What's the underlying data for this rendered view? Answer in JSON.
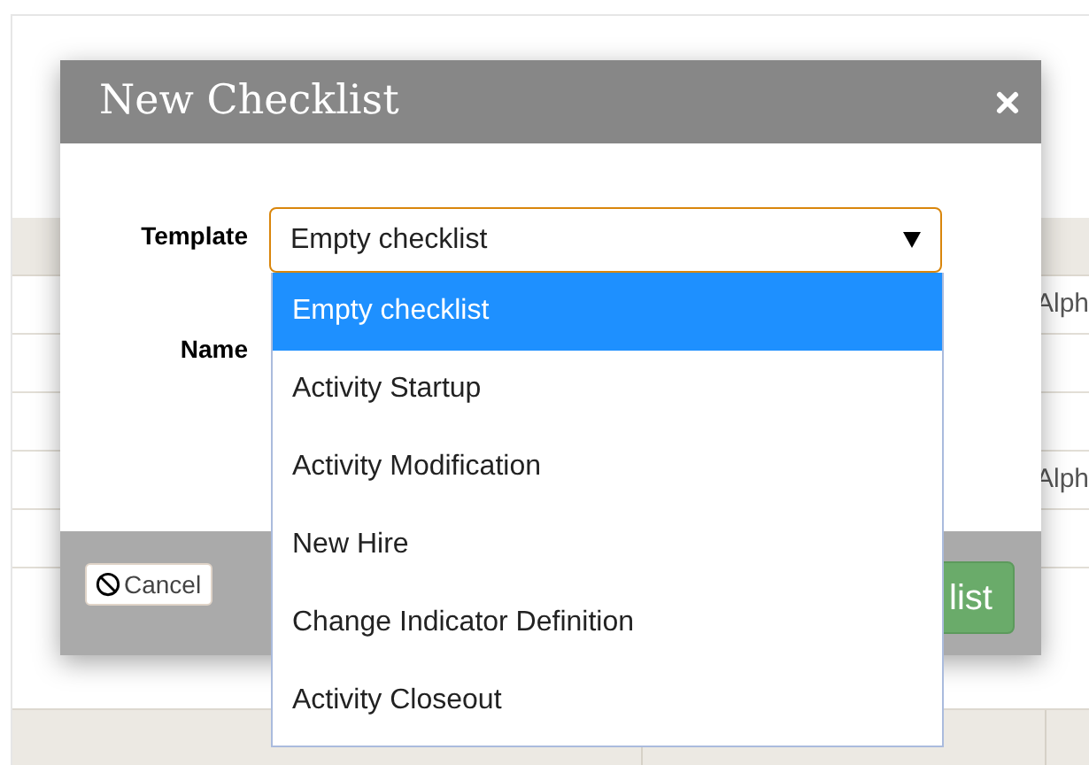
{
  "background_table": {
    "rows": [
      {
        "column_1": "Alph"
      },
      {},
      {},
      {
        "column_1": "Alph"
      },
      {}
    ]
  },
  "dialog": {
    "title": "New Checklist",
    "template_label": "Template",
    "template_value": "Empty checklist",
    "name_label": "Name",
    "template_options": [
      {
        "label": "Empty checklist",
        "selected": true
      },
      {
        "label": "Activity Startup",
        "selected": false
      },
      {
        "label": "Activity Modification",
        "selected": false
      },
      {
        "label": "New Hire",
        "selected": false
      },
      {
        "label": "Change Indicator Definition",
        "selected": false
      },
      {
        "label": "Activity Closeout",
        "selected": false
      }
    ],
    "cancel_button": "Cancel",
    "create_button": "list"
  }
}
